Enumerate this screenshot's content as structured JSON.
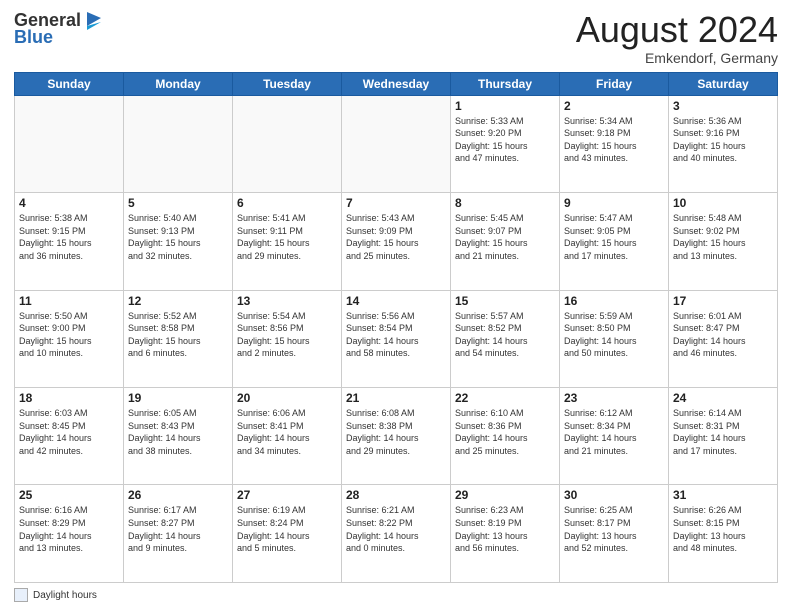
{
  "header": {
    "logo_general": "General",
    "logo_blue": "Blue",
    "title": "August 2024",
    "location": "Emkendorf, Germany"
  },
  "calendar": {
    "days_of_week": [
      "Sunday",
      "Monday",
      "Tuesday",
      "Wednesday",
      "Thursday",
      "Friday",
      "Saturday"
    ],
    "weeks": [
      [
        {
          "day": "",
          "info": ""
        },
        {
          "day": "",
          "info": ""
        },
        {
          "day": "",
          "info": ""
        },
        {
          "day": "",
          "info": ""
        },
        {
          "day": "1",
          "info": "Sunrise: 5:33 AM\nSunset: 9:20 PM\nDaylight: 15 hours\nand 47 minutes."
        },
        {
          "day": "2",
          "info": "Sunrise: 5:34 AM\nSunset: 9:18 PM\nDaylight: 15 hours\nand 43 minutes."
        },
        {
          "day": "3",
          "info": "Sunrise: 5:36 AM\nSunset: 9:16 PM\nDaylight: 15 hours\nand 40 minutes."
        }
      ],
      [
        {
          "day": "4",
          "info": "Sunrise: 5:38 AM\nSunset: 9:15 PM\nDaylight: 15 hours\nand 36 minutes."
        },
        {
          "day": "5",
          "info": "Sunrise: 5:40 AM\nSunset: 9:13 PM\nDaylight: 15 hours\nand 32 minutes."
        },
        {
          "day": "6",
          "info": "Sunrise: 5:41 AM\nSunset: 9:11 PM\nDaylight: 15 hours\nand 29 minutes."
        },
        {
          "day": "7",
          "info": "Sunrise: 5:43 AM\nSunset: 9:09 PM\nDaylight: 15 hours\nand 25 minutes."
        },
        {
          "day": "8",
          "info": "Sunrise: 5:45 AM\nSunset: 9:07 PM\nDaylight: 15 hours\nand 21 minutes."
        },
        {
          "day": "9",
          "info": "Sunrise: 5:47 AM\nSunset: 9:05 PM\nDaylight: 15 hours\nand 17 minutes."
        },
        {
          "day": "10",
          "info": "Sunrise: 5:48 AM\nSunset: 9:02 PM\nDaylight: 15 hours\nand 13 minutes."
        }
      ],
      [
        {
          "day": "11",
          "info": "Sunrise: 5:50 AM\nSunset: 9:00 PM\nDaylight: 15 hours\nand 10 minutes."
        },
        {
          "day": "12",
          "info": "Sunrise: 5:52 AM\nSunset: 8:58 PM\nDaylight: 15 hours\nand 6 minutes."
        },
        {
          "day": "13",
          "info": "Sunrise: 5:54 AM\nSunset: 8:56 PM\nDaylight: 15 hours\nand 2 minutes."
        },
        {
          "day": "14",
          "info": "Sunrise: 5:56 AM\nSunset: 8:54 PM\nDaylight: 14 hours\nand 58 minutes."
        },
        {
          "day": "15",
          "info": "Sunrise: 5:57 AM\nSunset: 8:52 PM\nDaylight: 14 hours\nand 54 minutes."
        },
        {
          "day": "16",
          "info": "Sunrise: 5:59 AM\nSunset: 8:50 PM\nDaylight: 14 hours\nand 50 minutes."
        },
        {
          "day": "17",
          "info": "Sunrise: 6:01 AM\nSunset: 8:47 PM\nDaylight: 14 hours\nand 46 minutes."
        }
      ],
      [
        {
          "day": "18",
          "info": "Sunrise: 6:03 AM\nSunset: 8:45 PM\nDaylight: 14 hours\nand 42 minutes."
        },
        {
          "day": "19",
          "info": "Sunrise: 6:05 AM\nSunset: 8:43 PM\nDaylight: 14 hours\nand 38 minutes."
        },
        {
          "day": "20",
          "info": "Sunrise: 6:06 AM\nSunset: 8:41 PM\nDaylight: 14 hours\nand 34 minutes."
        },
        {
          "day": "21",
          "info": "Sunrise: 6:08 AM\nSunset: 8:38 PM\nDaylight: 14 hours\nand 29 minutes."
        },
        {
          "day": "22",
          "info": "Sunrise: 6:10 AM\nSunset: 8:36 PM\nDaylight: 14 hours\nand 25 minutes."
        },
        {
          "day": "23",
          "info": "Sunrise: 6:12 AM\nSunset: 8:34 PM\nDaylight: 14 hours\nand 21 minutes."
        },
        {
          "day": "24",
          "info": "Sunrise: 6:14 AM\nSunset: 8:31 PM\nDaylight: 14 hours\nand 17 minutes."
        }
      ],
      [
        {
          "day": "25",
          "info": "Sunrise: 6:16 AM\nSunset: 8:29 PM\nDaylight: 14 hours\nand 13 minutes."
        },
        {
          "day": "26",
          "info": "Sunrise: 6:17 AM\nSunset: 8:27 PM\nDaylight: 14 hours\nand 9 minutes."
        },
        {
          "day": "27",
          "info": "Sunrise: 6:19 AM\nSunset: 8:24 PM\nDaylight: 14 hours\nand 5 minutes."
        },
        {
          "day": "28",
          "info": "Sunrise: 6:21 AM\nSunset: 8:22 PM\nDaylight: 14 hours\nand 0 minutes."
        },
        {
          "day": "29",
          "info": "Sunrise: 6:23 AM\nSunset: 8:19 PM\nDaylight: 13 hours\nand 56 minutes."
        },
        {
          "day": "30",
          "info": "Sunrise: 6:25 AM\nSunset: 8:17 PM\nDaylight: 13 hours\nand 52 minutes."
        },
        {
          "day": "31",
          "info": "Sunrise: 6:26 AM\nSunset: 8:15 PM\nDaylight: 13 hours\nand 48 minutes."
        }
      ]
    ]
  },
  "legend": {
    "label": "Daylight hours"
  }
}
